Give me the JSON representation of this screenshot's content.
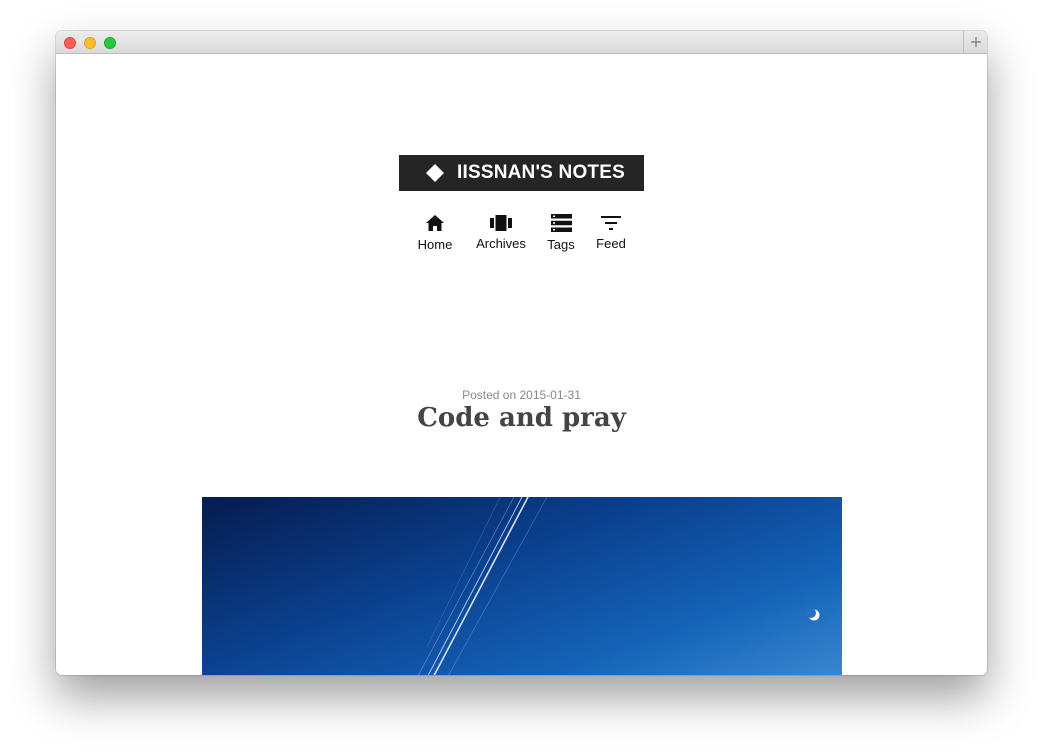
{
  "window": {
    "traffic_lights": [
      "close",
      "minimize",
      "zoom"
    ],
    "new_tab_icon": "plus-icon"
  },
  "site": {
    "logo_icon": "diamond-icon",
    "title": "IISSNAN'S NOTES"
  },
  "nav": {
    "home": {
      "label": "Home",
      "icon": "home-icon"
    },
    "archives": {
      "label": "Archives",
      "icon": "archive-icon"
    },
    "tags": {
      "label": "Tags",
      "icon": "tags-list-icon"
    },
    "feed": {
      "label": "Feed",
      "icon": "filter-icon"
    }
  },
  "post": {
    "posted_prefix": "Posted on",
    "date": "2015-01-31",
    "title": "Code and pray",
    "image": "night sky with star trails and moon"
  },
  "colors": {
    "logo_bg": "#252525",
    "title_text": "#444444",
    "meta_text": "#888888",
    "sky_top": "#061c4f",
    "sky_bottom": "#3d8ad2"
  }
}
